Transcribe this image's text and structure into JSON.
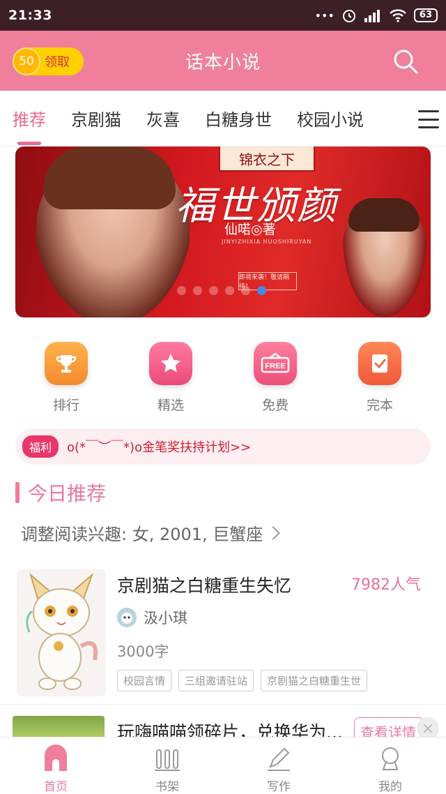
{
  "status": {
    "time": "21:33",
    "signal_dots": "•••",
    "battery": "63"
  },
  "header": {
    "coin_count": "50",
    "coin_label": "领取",
    "title": "话本小说",
    "search_icon": "search-icon"
  },
  "tabs": [
    {
      "label": "推荐",
      "active": true
    },
    {
      "label": "京剧猫",
      "active": false
    },
    {
      "label": "灰喜",
      "active": false
    },
    {
      "label": "白糖身世",
      "active": false
    },
    {
      "label": "校园小说",
      "active": false
    }
  ],
  "banner": {
    "sign": "锦衣之下",
    "title": "福世颁颜",
    "author": "仙喏◎著",
    "subtitle": "JINYIZHIXIA HUOSHIRUYAN",
    "tag": "即将来袭！敬请期待！",
    "dot_count": 6,
    "active_dot": 5
  },
  "quick_nav": [
    {
      "label": "排行",
      "icon": "trophy-icon",
      "color": "#f79a3a"
    },
    {
      "label": "精选",
      "icon": "star-icon",
      "color": "#f05b8a"
    },
    {
      "label": "免费",
      "icon": "free-tag-icon",
      "color": "#f05b7f"
    },
    {
      "label": "完本",
      "icon": "checklist-icon",
      "color": "#f66a44"
    }
  ],
  "notice": {
    "badge": "福利",
    "text": "o(*￣︶￣*)o金笔奖扶持计划>>"
  },
  "section": {
    "title": "今日推荐"
  },
  "interest": {
    "text": "调整阅读兴趣: 女, 2001, 巨蟹座"
  },
  "books": [
    {
      "title": "京剧猫之白糖重生失忆",
      "hot": "7982人气",
      "author": "汲小琪",
      "words": "3000字",
      "tags": [
        "校园言情",
        "三组邀请驻站",
        "京剧猫之白糖重生世"
      ]
    },
    {
      "title": "玩嗨喵喵领碎片，兑换华为...",
      "button": "查看详情"
    }
  ],
  "bottom_nav": [
    {
      "label": "首页",
      "icon": "home-icon",
      "active": true
    },
    {
      "label": "书架",
      "icon": "bookshelf-icon",
      "active": false
    },
    {
      "label": "写作",
      "icon": "pen-icon",
      "active": false
    },
    {
      "label": "我的",
      "icon": "user-icon",
      "active": false
    }
  ],
  "colors": {
    "accent": "#f07f9b",
    "status_bar": "#3d1f28",
    "notice_text": "#d21d30"
  }
}
